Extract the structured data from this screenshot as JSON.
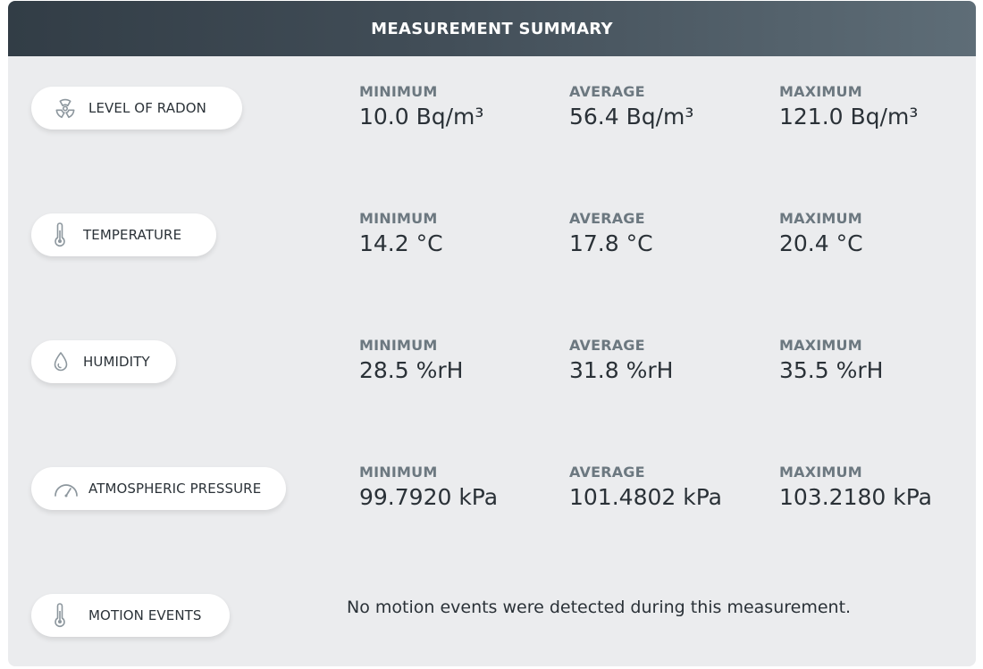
{
  "header": {
    "title": "MEASUREMENT SUMMARY"
  },
  "rows": [
    {
      "label": "LEVEL OF RADON",
      "icon": "radiation-icon",
      "min_label": "MINIMUM",
      "min_value": "10.0 Bq/m³",
      "avg_label": "AVERAGE",
      "avg_value": "56.4 Bq/m³",
      "max_label": "MAXIMUM",
      "max_value": "121.0 Bq/m³"
    },
    {
      "label": "TEMPERATURE",
      "icon": "thermometer-icon",
      "min_label": "MINIMUM",
      "min_value": "14.2 °C",
      "avg_label": "AVERAGE",
      "avg_value": "17.8 °C",
      "max_label": "MAXIMUM",
      "max_value": "20.4 °C"
    },
    {
      "label": "HUMIDITY",
      "icon": "droplet-icon",
      "min_label": "MINIMUM",
      "min_value": "28.5 %rH",
      "avg_label": "AVERAGE",
      "avg_value": "31.8 %rH",
      "max_label": "MAXIMUM",
      "max_value": "35.5 %rH"
    },
    {
      "label": "ATMOSPHERIC PRESSURE",
      "icon": "gauge-icon",
      "min_label": "MINIMUM",
      "min_value": "99.7920 kPa",
      "avg_label": "AVERAGE",
      "avg_value": "101.4802 kPa",
      "max_label": "MAXIMUM",
      "max_value": "103.2180 kPa"
    }
  ],
  "motion": {
    "label": "MOTION EVENTS",
    "icon": "thermometer-icon",
    "message": "No motion events were detected during this measurement."
  },
  "colors": {
    "header_dark": "#323d46",
    "header_light": "#5e6d77",
    "background": "#ebecee",
    "label_gray": "#6c7880",
    "value_dark": "#2a3137",
    "icon_gray": "#8d979e"
  }
}
